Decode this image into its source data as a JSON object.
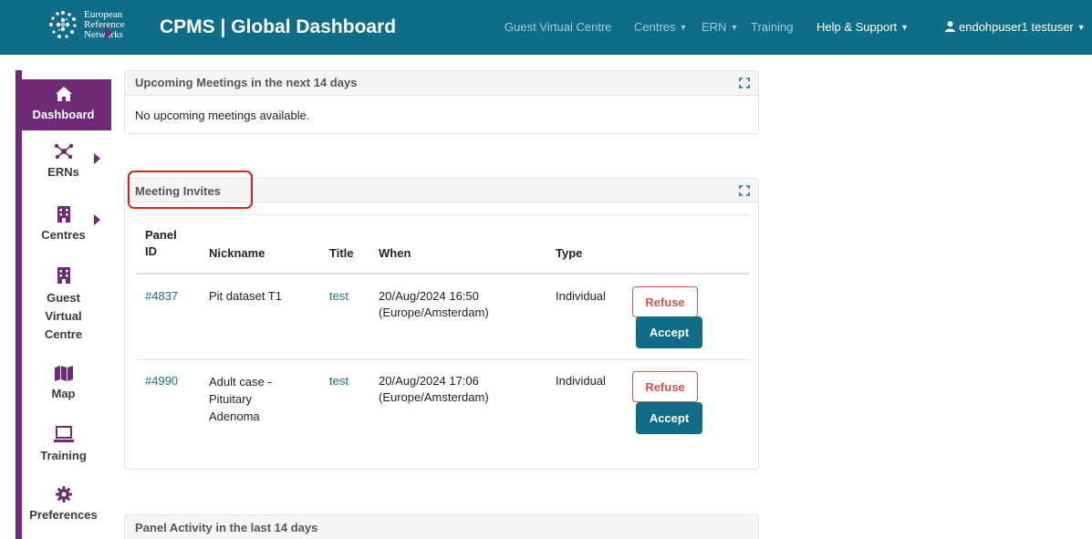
{
  "brand": {
    "line1": "European",
    "line2": "Reference",
    "line3": "Networks"
  },
  "app_title": "CPMS | Global Dashboard",
  "nav": {
    "guest_virtual_centre": "Guest Virtual Centre",
    "centres": "Centres",
    "ern": "ERN",
    "training": "Training",
    "help_support": "Help & Support",
    "user": "endohpuser1 testuser"
  },
  "sidebar": {
    "items": [
      {
        "label": "Dashboard",
        "icon": "home-icon"
      },
      {
        "label": "ERNs",
        "icon": "network-icon"
      },
      {
        "label": "Centres",
        "icon": "building-icon"
      },
      {
        "label": "Guest Virtual Centre",
        "icon": "building-icon"
      },
      {
        "label": "Map",
        "icon": "map-icon"
      },
      {
        "label": "Training",
        "icon": "laptop-icon"
      },
      {
        "label": "Preferences",
        "icon": "gear-icon"
      }
    ],
    "guest_lines": [
      "Guest",
      "Virtual",
      "Centre"
    ]
  },
  "upcoming": {
    "title": "Upcoming Meetings in the next 14 days",
    "empty_text": "No upcoming meetings available."
  },
  "invites": {
    "title": "Meeting Invites",
    "columns": {
      "panel_id_1": "Panel",
      "panel_id_2": "ID",
      "nickname": "Nickname",
      "title": "Title",
      "when": "When",
      "type": "Type"
    },
    "rows": [
      {
        "panel_id": "#4837",
        "nickname_lines": [
          "Pit dataset T1"
        ],
        "title": "test",
        "when_date": "20/Aug/2024 16:50",
        "when_tz": "(Europe/Amsterdam)",
        "type": "Individual",
        "refuse": "Refuse",
        "accept": "Accept"
      },
      {
        "panel_id": "#4990",
        "nickname_lines": [
          "Adult case -",
          "Pituitary",
          "Adenoma"
        ],
        "title": "test",
        "when_date": "20/Aug/2024 17:06",
        "when_tz": "(Europe/Amsterdam)",
        "type": "Individual",
        "refuse": "Refuse",
        "accept": "Accept"
      }
    ]
  },
  "activity": {
    "title": "Panel Activity in the last 14 days"
  },
  "colors": {
    "navbar": "#106d87",
    "sidebar_accent": "#6f2a78",
    "refuse": "#d9534f",
    "highlight": "#e01b1b"
  }
}
